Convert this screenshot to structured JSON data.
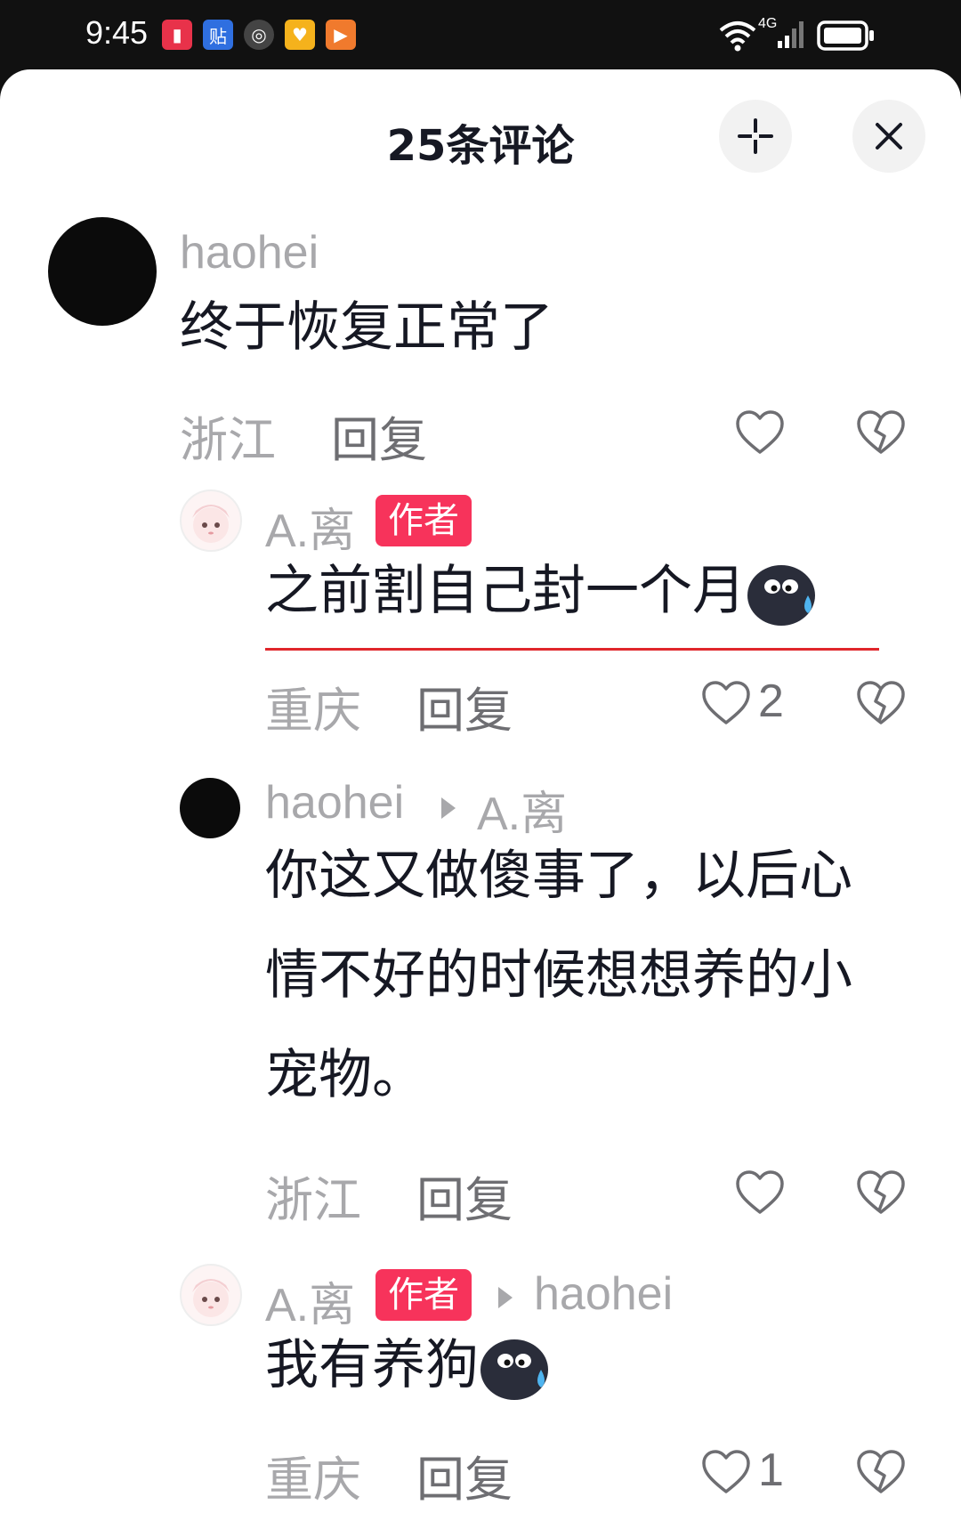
{
  "status_bar": {
    "time": "9:45",
    "network": "4G"
  },
  "header": {
    "title": "25条评论"
  },
  "comments": [
    {
      "username": "haohei",
      "text": "终于恢复正常了",
      "location": "浙江",
      "reply": "回复",
      "likes": ""
    },
    {
      "username": "A.离",
      "badge": "作者",
      "text": "之前割自己封一个月",
      "location": "重庆",
      "reply": "回复",
      "likes": "2"
    },
    {
      "username": "haohei",
      "reply_to": "A.离",
      "text_lines": [
        "你这又做傻事了，以后心",
        "情不好的时候想想养的小",
        "宠物。"
      ],
      "location": "浙江",
      "reply": "回复",
      "likes": ""
    },
    {
      "username": "A.离",
      "badge": "作者",
      "reply_to": "haohei",
      "text": "我有养狗",
      "location": "重庆",
      "reply": "回复",
      "likes": "1"
    }
  ]
}
